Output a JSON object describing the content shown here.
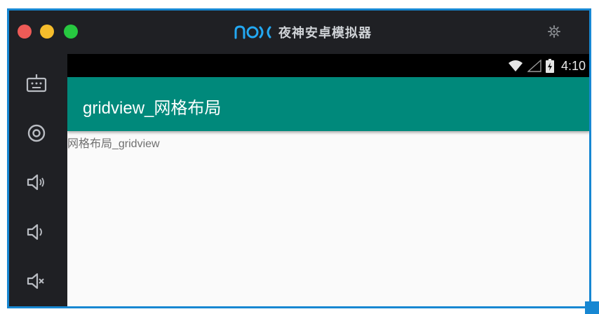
{
  "window": {
    "title": "夜神安卓模拟器",
    "brand_icon": "nox-logo-icon",
    "accent_color": "#1787d2",
    "controls": [
      "close-icon",
      "minimize-icon",
      "maximize-icon"
    ],
    "settings_icon": "gear-icon"
  },
  "sidebar": {
    "items": [
      {
        "name": "keyboard-icon"
      },
      {
        "name": "location-icon"
      },
      {
        "name": "volume-up-icon"
      },
      {
        "name": "volume-down-icon"
      },
      {
        "name": "mute-icon"
      }
    ]
  },
  "android": {
    "status_bar": {
      "time": "4:10",
      "icons": [
        "wifi-icon",
        "signal-icon",
        "battery-icon"
      ]
    },
    "toolbar": {
      "title": "gridview_网格布局",
      "color": "#00897b"
    },
    "content": {
      "text": "网格布局_gridview"
    }
  }
}
